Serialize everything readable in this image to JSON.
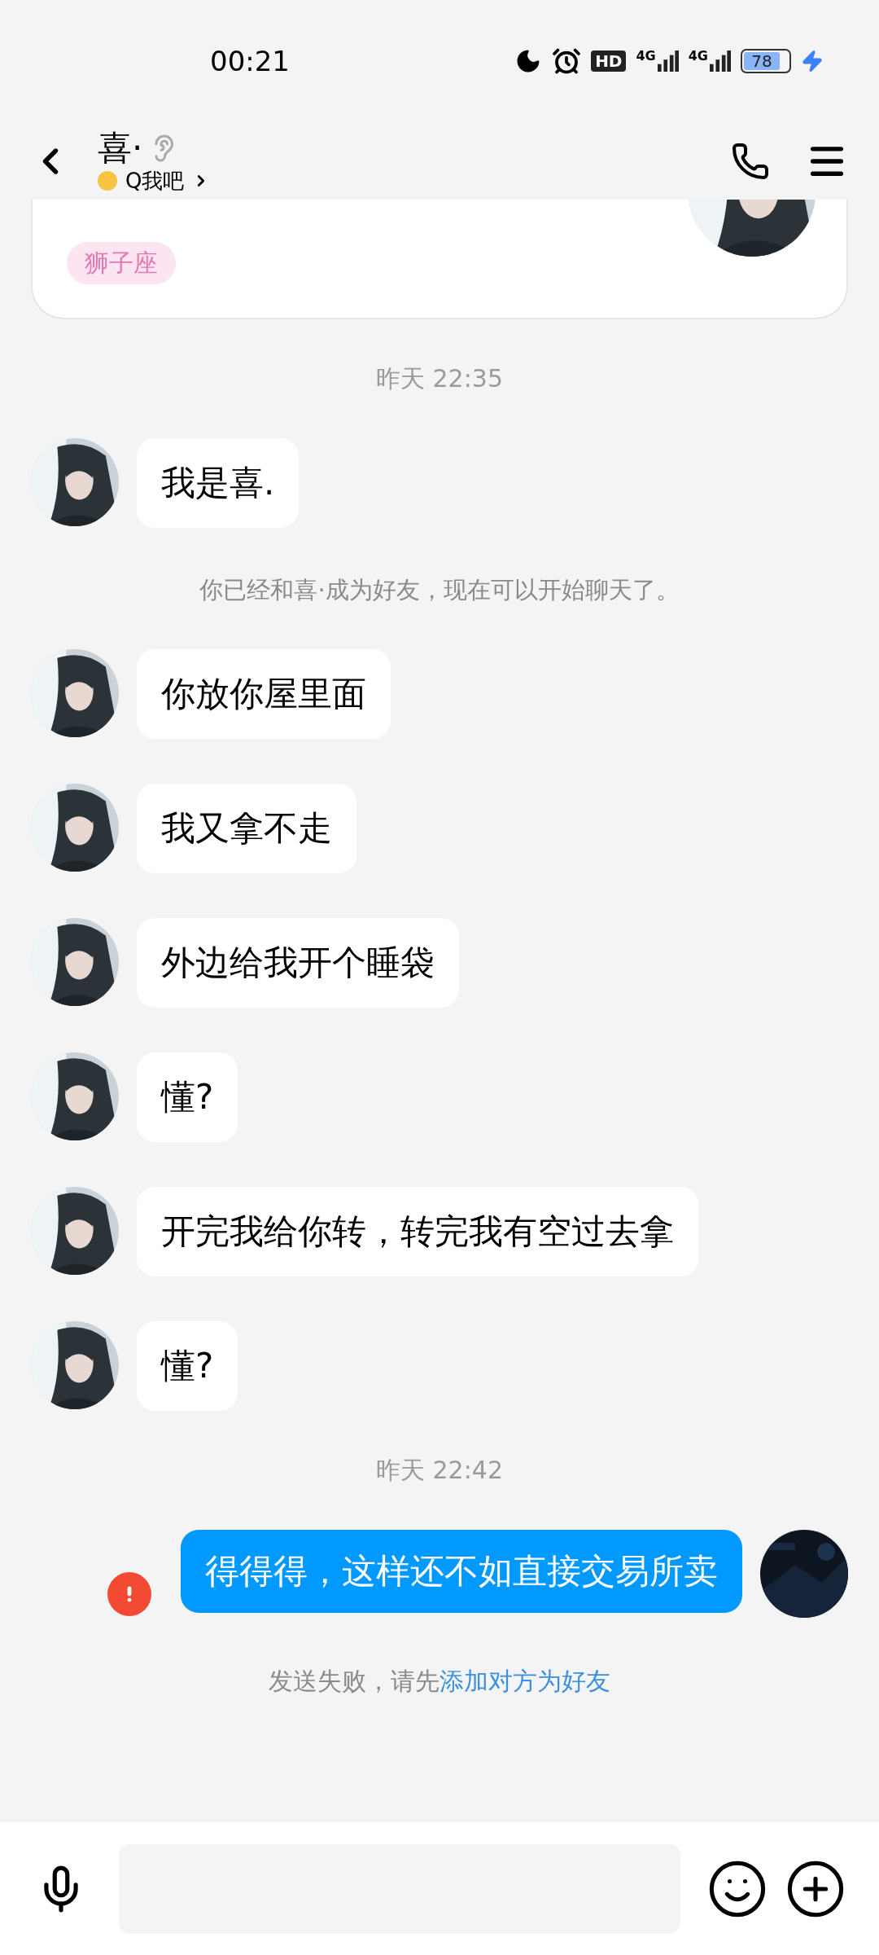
{
  "status_bar": {
    "time": "00:21",
    "hd_label": "HD",
    "signals": [
      {
        "label": "4G"
      },
      {
        "label": "4G"
      }
    ],
    "battery": "78",
    "charging": true
  },
  "header": {
    "title": "喜·",
    "subtitle": "Q我吧"
  },
  "profile_card": {
    "tag": "狮子座"
  },
  "messages": [
    {
      "kind": "time",
      "text": "昨天 22:35"
    },
    {
      "kind": "received",
      "text": "我是喜."
    },
    {
      "kind": "system",
      "text": "你已经和喜·成为好友，现在可以开始聊天了。"
    },
    {
      "kind": "received",
      "text": "你放你屋里面"
    },
    {
      "kind": "received",
      "text": "我又拿不走"
    },
    {
      "kind": "received",
      "text": "外边给我开个睡袋"
    },
    {
      "kind": "received",
      "text": "懂?"
    },
    {
      "kind": "received",
      "text": "开完我给你转，转完我有空过去拿"
    },
    {
      "kind": "received",
      "text": "懂?"
    },
    {
      "kind": "time",
      "text": "昨天 22:42"
    },
    {
      "kind": "sent",
      "text": "得得得，这样还不如直接交易所卖",
      "failed": true
    },
    {
      "kind": "notice",
      "text": "发送失败，请先",
      "link": "添加对方为好友"
    }
  ]
}
